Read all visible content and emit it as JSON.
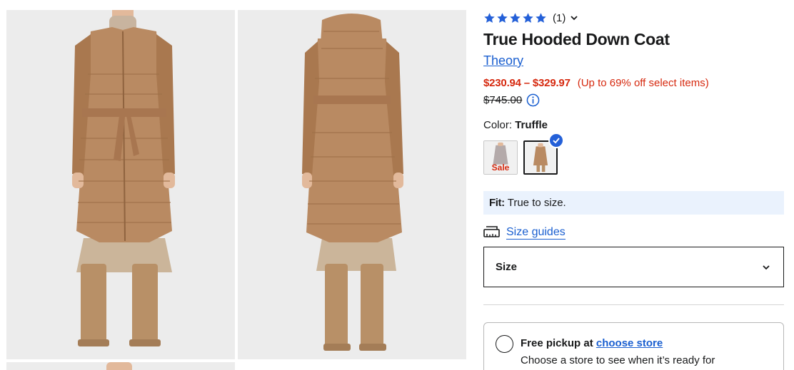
{
  "gallery": {
    "images": [
      {
        "name": "front view"
      },
      {
        "name": "back view"
      },
      {
        "name": "third view"
      }
    ]
  },
  "product": {
    "rating": {
      "stars": 5,
      "count_label": "(1)"
    },
    "title": "True Hooded Down Coat",
    "brand": "Theory",
    "price_range": "$230.94 – $329.97",
    "promo": "(Up to 69% off select items)",
    "original_price": "$745.00",
    "color_label": "Color:",
    "color_value": "Truffle",
    "swatches": [
      {
        "name": "grey",
        "sale_label": "Sale",
        "selected": false
      },
      {
        "name": "truffle",
        "selected": true
      }
    ],
    "fit": {
      "key": "Fit:",
      "value": "True to size."
    },
    "size_guides_label": "Size guides",
    "size_select": {
      "label": "Size"
    },
    "pickup": {
      "prefix": "Free pickup at",
      "link": "choose store",
      "subtext": "Choose a store to see when it’s ready for"
    }
  },
  "colors": {
    "accent_blue": "#1a5fd0",
    "sale_red": "#d6290f",
    "star_blue": "#2460d8",
    "fit_bg": "#eaf2fd",
    "coat_brown": "#b98a62"
  }
}
